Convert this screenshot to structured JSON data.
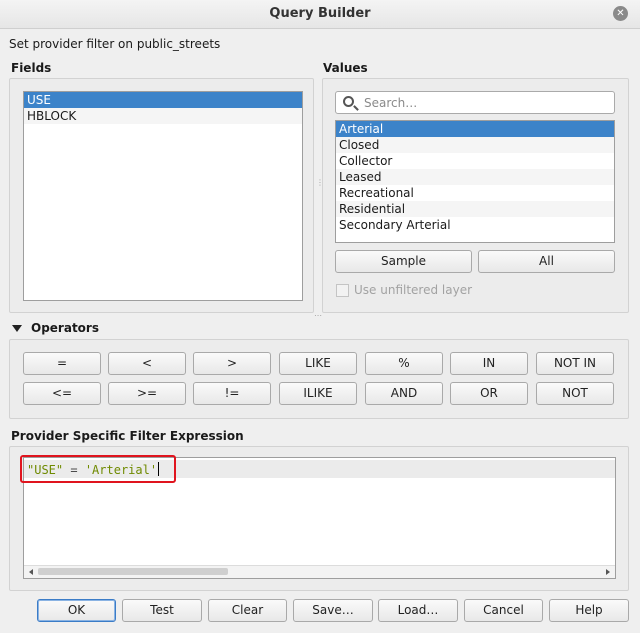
{
  "window": {
    "title": "Query Builder",
    "close_icon": "close-icon"
  },
  "subtitle": "Set provider filter on public_streets",
  "fields": {
    "label": "Fields",
    "items": [
      "USE",
      "HBLOCK"
    ],
    "selected": "USE"
  },
  "values": {
    "label": "Values",
    "search_placeholder": "Search…",
    "items": [
      "Arterial",
      "Closed",
      "Collector",
      "Leased",
      "Recreational",
      "Residential",
      "Secondary Arterial"
    ],
    "selected": "Arterial",
    "sample_label": "Sample",
    "all_label": "All",
    "unfiltered_label": "Use unfiltered layer",
    "unfiltered_checked": false
  },
  "operators": {
    "label": "Operators",
    "row1": [
      "=",
      "<",
      ">",
      "LIKE",
      "%",
      "IN",
      "NOT IN"
    ],
    "row2": [
      "<=",
      ">=",
      "!=",
      "ILIKE",
      "AND",
      "OR",
      "NOT"
    ]
  },
  "expression": {
    "label": "Provider Specific Filter Expression",
    "field": "\"USE\"",
    "operator": "=",
    "value": "'Arterial'"
  },
  "buttons": {
    "ok": "OK",
    "test": "Test",
    "clear": "Clear",
    "save": "Save…",
    "load": "Load…",
    "cancel": "Cancel",
    "help": "Help"
  },
  "colors": {
    "selection": "#3c83c9",
    "highlight_box": "#e0141e",
    "string_token": "#6f8a00"
  }
}
